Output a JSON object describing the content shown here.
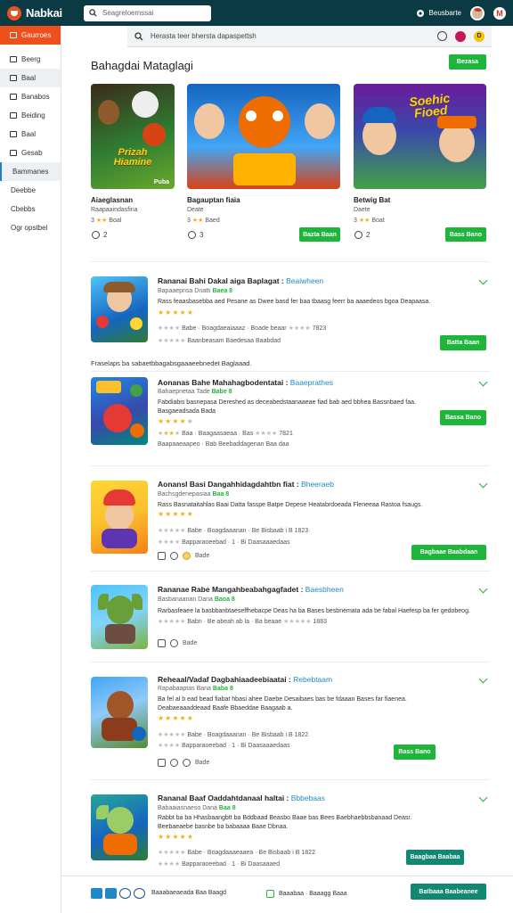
{
  "topbar": {
    "logo_text": "Nabkai",
    "search_placeholder": "Seagreloemssai",
    "user_label": "Beusbarte",
    "mail_badge": "M"
  },
  "sidebar": {
    "items": [
      {
        "label": "Gaurroes",
        "icon": "home-icon"
      },
      {
        "label": "Beerg",
        "icon": "grid-icon"
      },
      {
        "label": "Baal",
        "icon": "controller-icon"
      },
      {
        "label": "Banabos",
        "icon": "tag-icon"
      },
      {
        "label": "Beiding",
        "icon": "chat-icon"
      },
      {
        "label": "Baal",
        "icon": "card-icon"
      },
      {
        "label": "Gesab",
        "icon": "bookmark-icon"
      },
      {
        "label": "Bammanes",
        "icon": ""
      },
      {
        "label": "Deebbe",
        "icon": ""
      },
      {
        "label": "Cbebbs",
        "icon": ""
      },
      {
        "label": "Ogr opstbel",
        "icon": ""
      }
    ]
  },
  "search": {
    "query": "Herasta teer bhersta dapaspettsh",
    "coin_label": "D"
  },
  "featured": {
    "title": "Bahagdai Mataglagi",
    "view_all": "Bezasa",
    "cards": [
      {
        "art_text": "Prizah Hiamine",
        "badge": "Puba",
        "name": "Aiaeglasnan",
        "sub": "Raapaaindasfina",
        "meta": "3",
        "rating_text": "Boal",
        "clock": "2"
      },
      {
        "art_text": "",
        "badge": "",
        "name": "Bagauptan fiaia",
        "sub": "Deate",
        "meta": "3",
        "rating_text": "Baed",
        "clock": "3",
        "button": "Bazta Baan"
      },
      {
        "art_text": "Soehic Fioed",
        "badge": "",
        "name": "Betwig Bat",
        "sub": "Daete",
        "meta": "3",
        "rating_text": "Boat",
        "clock": "2",
        "button": "Bass Bano"
      }
    ]
  },
  "apps": [
    {
      "title": "Rananai Bahi Dakal aiga Baplagat :",
      "tag": "Beaiwheen",
      "sub": "Bapaaepnsa Dnatti",
      "sub_green": "Baea 8",
      "desc": [
        "Rass feaasbasebba aed Pesane as Dwee basd fer baa tbaasg feerr ba aaaedeos bgoa Deapaasa."
      ],
      "stars_line": "Babe · Boagdaeaiaaaz · Boade beaar",
      "stars_num": "7823",
      "footer_line": "Baanbeasam Baedesaa Baabdad",
      "button": "Batta Baan"
    },
    {
      "title": "Aonanas Bahe Mahahagbodentatai :",
      "tag": "Baaeprathes",
      "sub": "Bahaepnetaa Tade",
      "sub_green": "Babe 8",
      "desc": [
        "Fabdiabis basnepasa Dereshed as deceabedstaanaaeae fiad bab aed bbhea Bassnbaed faa.",
        "Basgaeadsada Bada"
      ],
      "stars_line": "Baa · Baagaasaeaa · Bas",
      "stars_num": "7821",
      "footer_line": "Baapaaeaapeo · Bab Beebaddagenan Baa daa",
      "button": "Bassa Bano"
    },
    {
      "title": "Aonansl Basi Dangahhidagdahtbn fiat :",
      "tag": "Bheeraeb",
      "sub": "Bachsgdenepasiaa",
      "sub_green": "Baa 8",
      "desc": [
        "Rass Basnataitahlas Baai Datta fasspe Batpe Depese Heatabrdoeada Fleneeaa Rastoa fsaugs."
      ],
      "stars_line": "Babe · Boagdaaanan · Be Bisbaab i B",
      "stars_num": "1823",
      "footer_line": "Bapparaoeebad · 1 · Bi Daasaaaedaas",
      "mini": "Bade",
      "button": "Bagbaae Baabdaan"
    },
    {
      "title": "Rananae Rabe Mangahbeabahgagfadet :",
      "tag": "Baesbheen",
      "sub": "Basbanaanan Dana",
      "sub_green": "Baoa 8",
      "desc": [
        "Rarbasfeaee la basbbanbtaeseffhebacpe Deas ha ba Bases besbnemata ada be fabal Haefesp ba fer gedobeog."
      ],
      "stars_line": "Babn · Be abeah ab la · Ba beaae",
      "stars_num": "1883",
      "footer_line": "",
      "mini": "Bade"
    },
    {
      "title": "Reheaal/Vadaf Dagbahiaadeebiaatai :",
      "tag": "Rebebtaam",
      "sub": "Rapabaaptas Bana",
      "sub_green": "Baba 8",
      "desc": [
        "Ba fel al b ead bead fiabat hbasi ahee Daebe Desaibaes bas be fdaaan Bases far fiaenea.",
        "Deabaeaaaddeaad Baafe Bbaeddae Baagaab a."
      ],
      "stars_line": "Babe · Boagdaaanan · Be Bisbaab i B",
      "stars_num": "1822",
      "footer_line": "Bapparaoeebad · 1 · Bi Daasaaaedaas",
      "mini": "Bade",
      "button": "Bass Bano"
    },
    {
      "title": "Rananal Baaf Oaddahtdanaal haltai :",
      "tag": "Bbbebaas",
      "sub": "Babaaiasnaeso Dana",
      "sub_green": "Baa 8",
      "desc": [
        "Rabbt ba ba Hhasbaangbtt ba Bddbaad Beasbo Baae bas Bees Baebhaebbsbanaad Deasr.",
        "Beebaeaebe basnbe ba babaaaa Baae Dbnaa."
      ],
      "stars_line": "Babe · Boagdaaaeaaea · Be Bisbaab i B",
      "stars_num": "1822",
      "footer_line": "Bapparaoeebad · 1 · Bi Daasaaaed",
      "button": "Baagbaa Baabaa"
    }
  ],
  "loose_text": "Fraselaps ba sabaetbbagabsgaaaeebnedet Baglaaad.",
  "footer": {
    "text1": "Baaabaeaeada Baa Baagd",
    "text2": "Baaabaa · Baaagg Baaa",
    "button": "Batbaaa Baabeanee"
  },
  "colors": {
    "topbar": "#0b3a45",
    "accent_orange": "#ef4f1a",
    "green": "#1db53a",
    "teal": "#128872",
    "link_blue": "#1e88c8"
  }
}
